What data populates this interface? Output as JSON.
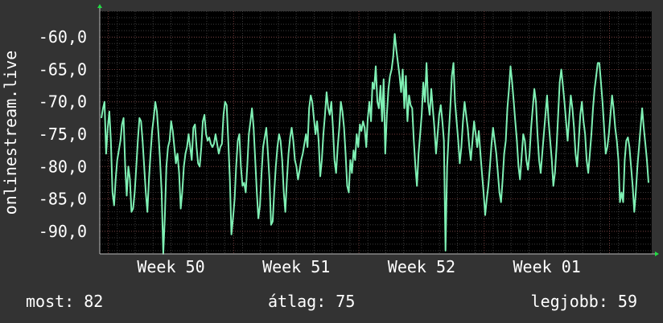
{
  "chart_data": {
    "type": "line",
    "title": "",
    "ylabel": "onlinestream.live",
    "xlabel": "",
    "ylim": [
      -93.5,
      -56.0
    ],
    "y_ticks": [
      {
        "value": -60,
        "label": "-60,0"
      },
      {
        "value": -65,
        "label": "-65,0"
      },
      {
        "value": -70,
        "label": "-70,0"
      },
      {
        "value": -75,
        "label": "-75,0"
      },
      {
        "value": -80,
        "label": "-80,0"
      },
      {
        "value": -85,
        "label": "-85,0"
      },
      {
        "value": -90,
        "label": "-90,0"
      }
    ],
    "x_ticks": [
      {
        "pos": 0.129,
        "label": "Week 50"
      },
      {
        "pos": 0.356,
        "label": "Week 51"
      },
      {
        "pos": 0.583,
        "label": "Week 52"
      },
      {
        "pos": 0.81,
        "label": "Week 01"
      }
    ],
    "grid": true,
    "series": [
      {
        "name": "",
        "color": "#7ff0b4",
        "values": [
          -72.5,
          -71.0,
          -70.0,
          -78.0,
          -74.0,
          -71.5,
          -76.0,
          -84.0,
          -86.0,
          -82.0,
          -79.0,
          -77.5,
          -76.0,
          -73.5,
          -72.5,
          -80.0,
          -84.5,
          -80.0,
          -82.0,
          -87.0,
          -86.5,
          -84.0,
          -80.0,
          -76.0,
          -72.5,
          -73.0,
          -76.0,
          -80.0,
          -84.0,
          -87.0,
          -82.0,
          -78.0,
          -74.5,
          -72.5,
          -70.0,
          -71.5,
          -75.0,
          -79.0,
          -84.0,
          -93.5,
          -88.0,
          -80.0,
          -77.0,
          -76.0,
          -73.0,
          -74.5,
          -77.0,
          -79.5,
          -78.0,
          -81.0,
          -86.5,
          -84.0,
          -80.0,
          -78.0,
          -77.0,
          -75.0,
          -77.0,
          -79.0,
          -74.0,
          -73.5,
          -77.0,
          -79.5,
          -80.0,
          -77.0,
          -73.0,
          -72.0,
          -75.0,
          -76.0,
          -75.5,
          -76.5,
          -77.0,
          -76.5,
          -75.0,
          -76.5,
          -78.0,
          -77.0,
          -76.5,
          -72.0,
          -70.0,
          -70.5,
          -76.0,
          -82.0,
          -90.5,
          -88.0,
          -85.0,
          -80.0,
          -76.0,
          -75.0,
          -80.0,
          -83.0,
          -82.5,
          -84.0,
          -80.0,
          -75.0,
          -73.0,
          -71.0,
          -74.0,
          -79.0,
          -84.0,
          -88.0,
          -86.0,
          -81.0,
          -77.0,
          -75.5,
          -74.0,
          -78.0,
          -82.0,
          -89.0,
          -88.5,
          -84.0,
          -80.0,
          -77.0,
          -75.0,
          -76.0,
          -79.0,
          -84.0,
          -87.0,
          -82.0,
          -78.0,
          -75.5,
          -74.0,
          -76.0,
          -79.0,
          -80.0,
          -82.0,
          -80.5,
          -79.0,
          -78.0,
          -76.5,
          -75.0,
          -77.0,
          -71.0,
          -69.0,
          -70.0,
          -72.5,
          -75.0,
          -73.0,
          -76.0,
          -81.5,
          -79.0,
          -75.0,
          -72.0,
          -68.5,
          -71.0,
          -72.0,
          -70.0,
          -74.0,
          -79.0,
          -81.0,
          -77.0,
          -74.0,
          -70.0,
          -71.5,
          -74.0,
          -78.0,
          -83.0,
          -84.0,
          -79.0,
          -81.0,
          -77.5,
          -79.0,
          -75.0,
          -77.0,
          -73.5,
          -74.5,
          -73.0,
          -74.0,
          -77.0,
          -72.5,
          -70.0,
          -73.0,
          -67.0,
          -68.0,
          -64.5,
          -70.0,
          -71.0,
          -67.5,
          -73.0,
          -66.5,
          -78.0,
          -72.0,
          -68.0,
          -66.0,
          -65.0,
          -63.0,
          -59.5,
          -62.0,
          -64.0,
          -66.0,
          -68.5,
          -65.0,
          -71.0,
          -66.0,
          -73.0,
          -69.0,
          -70.5,
          -71.0,
          -76.0,
          -80.0,
          -83.0,
          -78.0,
          -75.0,
          -72.0,
          -67.0,
          -70.0,
          -64.0,
          -70.0,
          -72.0,
          -68.0,
          -71.0,
          -74.0,
          -78.0,
          -75.0,
          -72.0,
          -70.5,
          -73.0,
          -76.0,
          -93.0,
          -80.0,
          -75.0,
          -71.0,
          -66.0,
          -64.0,
          -70.0,
          -73.0,
          -76.0,
          -79.5,
          -77.0,
          -73.0,
          -70.0,
          -72.0,
          -74.0,
          -77.0,
          -79.0,
          -76.0,
          -73.0,
          -75.0,
          -77.0,
          -74.5,
          -78.0,
          -81.0,
          -84.0,
          -87.5,
          -85.0,
          -83.0,
          -80.0,
          -76.5,
          -74.0,
          -76.0,
          -78.0,
          -81.0,
          -84.0,
          -85.5,
          -82.0,
          -78.0,
          -76.0,
          -71.0,
          -68.0,
          -64.5,
          -67.0,
          -70.0,
          -73.0,
          -76.0,
          -80.0,
          -82.0,
          -78.5,
          -75.0,
          -76.0,
          -79.0,
          -80.5,
          -78.0,
          -74.0,
          -71.0,
          -68.0,
          -70.0,
          -75.0,
          -79.0,
          -81.0,
          -78.0,
          -75.0,
          -72.0,
          -69.0,
          -73.0,
          -76.0,
          -79.0,
          -83.0,
          -81.0,
          -77.0,
          -72.0,
          -67.0,
          -65.0,
          -67.5,
          -70.0,
          -73.0,
          -76.0,
          -72.5,
          -69.0,
          -71.0,
          -74.0,
          -78.0,
          -80.0,
          -76.0,
          -72.0,
          -70.0,
          -73.0,
          -75.0,
          -79.0,
          -81.0,
          -78.0,
          -75.0,
          -71.0,
          -68.0,
          -66.0,
          -64.0,
          -64.0,
          -67.0,
          -70.0,
          -74.0,
          -78.0,
          -77.0,
          -75.0,
          -72.0,
          -69.0,
          -71.0,
          -74.0,
          -76.0,
          -79.0,
          -85.5,
          -84.0,
          -85.5,
          -79.0,
          -76.0,
          -75.5,
          -77.0,
          -80.0,
          -83.0,
          -87.0,
          -84.0,
          -80.0,
          -77.0,
          -74.0,
          -71.0,
          -74.0,
          -76.5,
          -79.0,
          -82.5
        ]
      }
    ]
  },
  "stats": {
    "current": "most: 82",
    "average": "átlag: 75",
    "max": "legjobb: 59"
  }
}
